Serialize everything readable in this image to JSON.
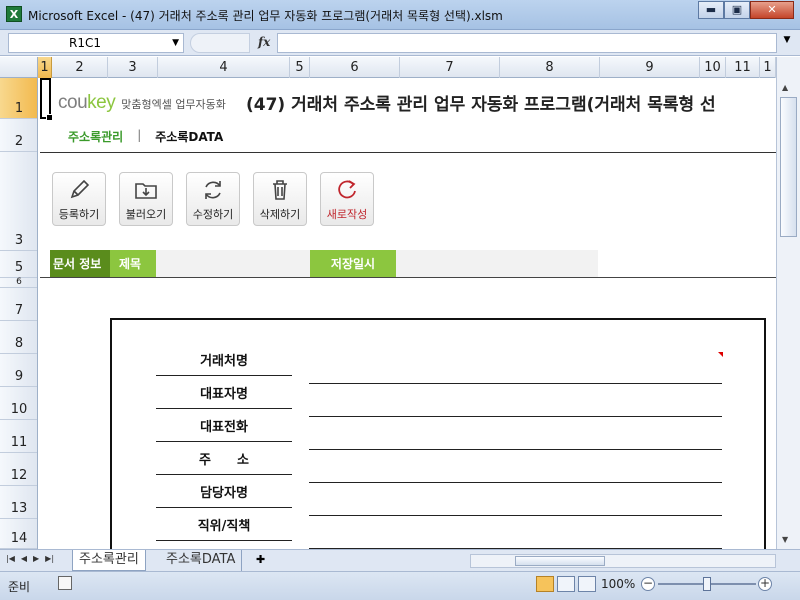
{
  "window": {
    "app_icon": "X",
    "title": "Microsoft Excel - (47) 거래처 주소록 관리 업무 자동화 프로그램(거래처 목록형 선택).xlsm",
    "minimize": "▬",
    "restore": "▣",
    "close": "✕"
  },
  "formula_bar": {
    "name_box": "R1C1",
    "fx": "fx",
    "formula": ""
  },
  "columns": [
    "1",
    "2",
    "3",
    "4",
    "5",
    "6",
    "7",
    "8",
    "9",
    "10",
    "11",
    "1"
  ],
  "rows": [
    "1",
    "2",
    "3",
    "5",
    "6",
    "7",
    "8",
    "9",
    "10",
    "11",
    "12",
    "13",
    "14"
  ],
  "header": {
    "brand_cou": "cou",
    "brand_key": "key",
    "brand_tag": "맞춤형엑셀 업무자동화",
    "title": "(47) 거래처 주소록 관리 업무 자동화 프로그램(거래처 목록형 선"
  },
  "nav": {
    "active": "주소록관리",
    "separator": "|",
    "other": "주소록DATA"
  },
  "toolbar": {
    "register": "등록하기",
    "load": "불러오기",
    "edit": "수정하기",
    "delete": "삭제하기",
    "new": "새로작성"
  },
  "doc_info": {
    "label": "문서 정보",
    "title_label": "제목",
    "title_value": "",
    "saved_label": "저장일시",
    "saved_value": ""
  },
  "form": {
    "fields": [
      "거래처명",
      "대표자명",
      "대표전화",
      "주　　소",
      "담당자명",
      "직위/직책"
    ]
  },
  "sheet_tabs": [
    "주소록관리",
    "주소록DATA"
  ],
  "status": {
    "ready": "준비",
    "zoom": "100%",
    "zoom_out": "−",
    "zoom_in": "+"
  },
  "colors": {
    "brand_green": "#8cc63f",
    "dark_green": "#5a8c1c",
    "nav_green": "#3a9a2a",
    "new_red": "#c0262d"
  }
}
